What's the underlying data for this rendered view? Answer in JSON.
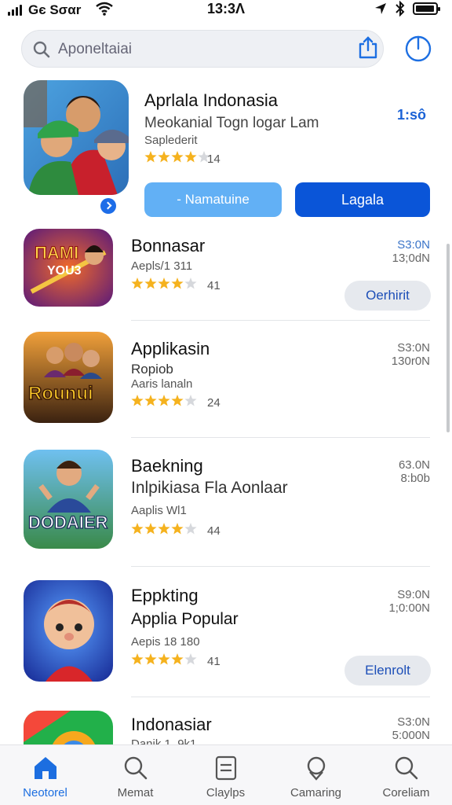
{
  "status_bar": {
    "carrier": "Gє Sσαr",
    "time": "13:3Λ"
  },
  "search": {
    "placeholder": "Αponeltaiai"
  },
  "featured": {
    "title": "Aprlala Indonasia",
    "subtitle": "Meokanial Togn logar Lam",
    "meta": "Saplederit",
    "rating": 4,
    "rating_count": "14",
    "price": "1:sô",
    "secondary_button": "- Namatuine",
    "primary_button": "Lagala"
  },
  "apps": [
    {
      "name": "Bonnasar",
      "line1": "Aepls/1 311",
      "rating": 4,
      "rating_count": "41",
      "size_top": "S3:0N",
      "size_bottom": "13;0dN",
      "action": "Oerhirit"
    },
    {
      "name": "Applikasin",
      "line1": "Ropiob",
      "line2": "Aaris lanaln",
      "rating": 4,
      "rating_count": "24",
      "size_top": "S3:0N",
      "size_bottom": "130r0N"
    },
    {
      "name": "Baekning",
      "line1": "Inlpikiasa Fla Aonlaar",
      "line2": "Aaplis Wl1",
      "rating": 4,
      "rating_count": "44",
      "size_top": "63.0N",
      "size_bottom": "8:b0b"
    },
    {
      "name": "Eppkting",
      "line1": "Applia Popular",
      "line2": "Aepis 18 180",
      "rating": 4,
      "rating_count": "41",
      "size_top": "S9:0N",
      "size_bottom": "1;0:00N",
      "action": "Elenrolt"
    },
    {
      "name": "Indonasiar",
      "line1": "Danik 1 .9k1",
      "size_top": "S3:0N",
      "size_bottom": "5:000N"
    }
  ],
  "tabs": [
    {
      "label": "Neotorel",
      "icon": "home-icon"
    },
    {
      "label": "Memat",
      "icon": "search-icon"
    },
    {
      "label": "Claylps",
      "icon": "document-icon"
    },
    {
      "label": "Camaring",
      "icon": "location-icon"
    },
    {
      "label": "Coreliam",
      "icon": "search-icon"
    }
  ],
  "colors": {
    "accent": "#0a55d8",
    "accent_light": "#62b0f5",
    "star": "#f5b21e"
  }
}
